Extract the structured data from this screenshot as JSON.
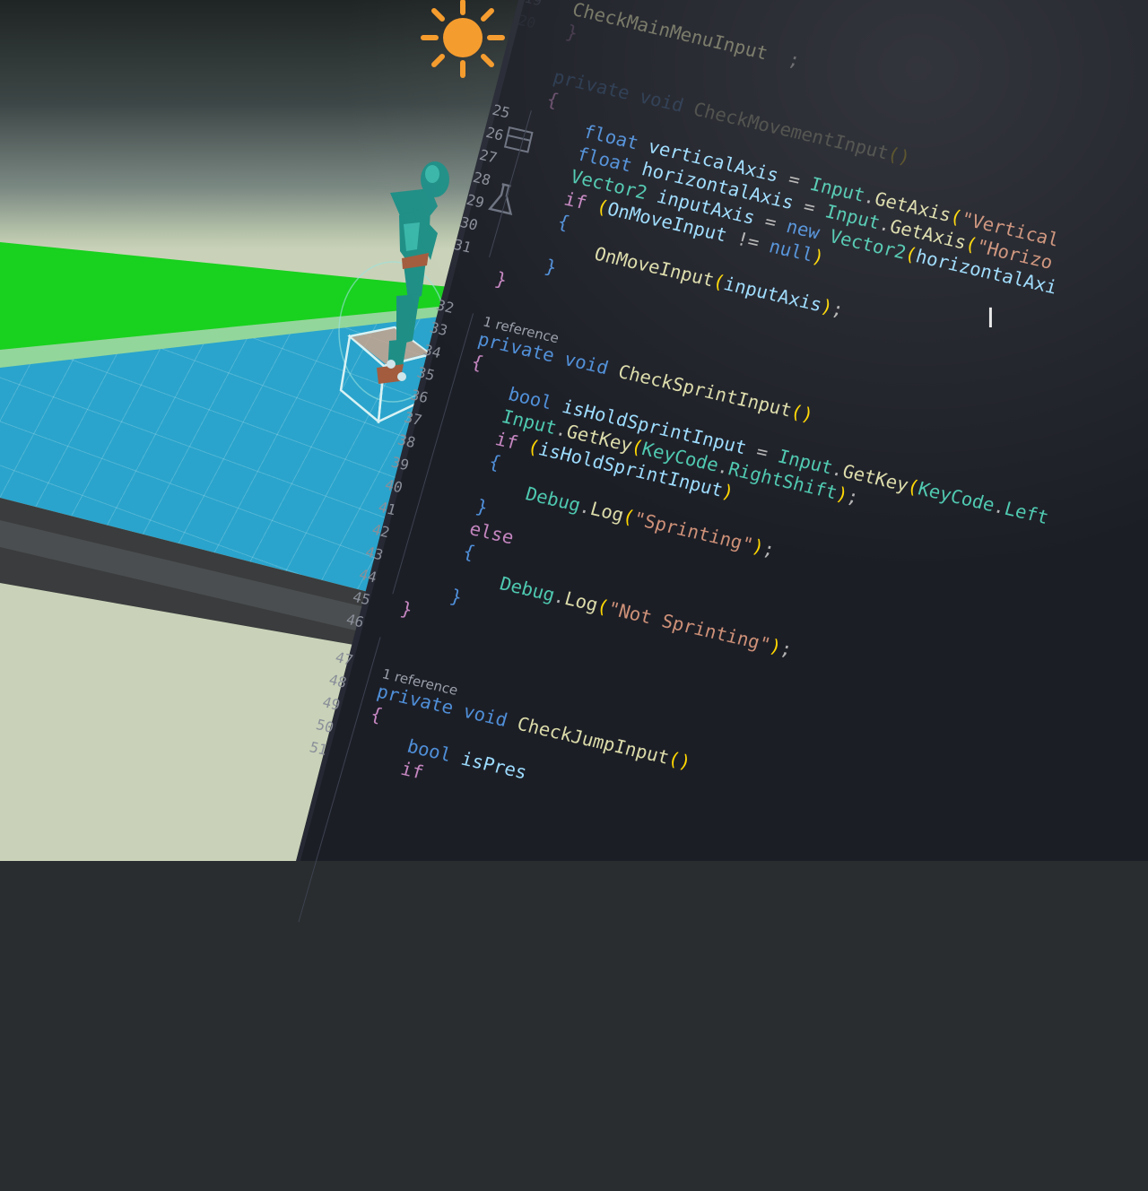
{
  "scene": {
    "sun_icon": "sun-icon",
    "character": "humanoid-character"
  },
  "editor": {
    "lines": [
      {
        "n": "18",
        "style": "faint2",
        "parts": []
      },
      {
        "n": "19",
        "style": "faint",
        "parts": [
          [
            "m",
            "CheckMainMenuInput"
          ],
          [
            "g",
            "  ;"
          ]
        ]
      },
      {
        "n": "20",
        "style": "faint2",
        "parts": [
          [
            "p",
            "}"
          ]
        ]
      },
      {
        "n": "",
        "style": "faint2",
        "parts": []
      },
      {
        "n": "",
        "style": "faint2",
        "parts": [
          [
            "k",
            "private void "
          ],
          [
            "m",
            "CheckMovementInput"
          ],
          [
            "y",
            "()"
          ]
        ]
      },
      {
        "n": "",
        "style": "faint",
        "parts": [
          [
            "p",
            "{"
          ]
        ]
      },
      {
        "n": "25",
        "style": "",
        "parts": [
          [
            "k",
            "    float "
          ],
          [
            "c",
            "verticalAxis"
          ],
          [
            "g",
            " = "
          ],
          [
            "t",
            "Input"
          ],
          [
            "g",
            "."
          ],
          [
            "m",
            "GetAxis"
          ],
          [
            "y",
            "("
          ],
          [
            "s",
            "\"Vertical"
          ]
        ]
      },
      {
        "n": "26",
        "style": "",
        "parts": [
          [
            "k",
            "    float "
          ],
          [
            "c",
            "horizontalAxis"
          ],
          [
            "g",
            " = "
          ],
          [
            "t",
            "Input"
          ],
          [
            "g",
            "."
          ],
          [
            "m",
            "GetAxis"
          ],
          [
            "y",
            "("
          ],
          [
            "s",
            "\"Horizo"
          ]
        ]
      },
      {
        "n": "27",
        "style": "",
        "parts": [
          [
            "t",
            "    Vector2 "
          ],
          [
            "c",
            "inputAxis"
          ],
          [
            "g",
            " = "
          ],
          [
            "k",
            "new "
          ],
          [
            "t",
            "Vector2"
          ],
          [
            "y",
            "("
          ],
          [
            "c",
            "horizontalAxi"
          ]
        ]
      },
      {
        "n": "28",
        "style": "",
        "parts": [
          [
            "p",
            "    if "
          ],
          [
            "y",
            "("
          ],
          [
            "c",
            "OnMoveInput"
          ],
          [
            "g",
            " != "
          ],
          [
            "k",
            "null"
          ],
          [
            "y",
            ")"
          ]
        ]
      },
      {
        "n": "29",
        "style": "",
        "parts": [
          [
            "k",
            "    {"
          ]
        ]
      },
      {
        "n": "30",
        "style": "",
        "parts": [
          [
            "m",
            "        OnMoveInput"
          ],
          [
            "y",
            "("
          ],
          [
            "c",
            "inputAxis"
          ],
          [
            "y",
            ")"
          ],
          [
            "g",
            ";"
          ]
        ]
      },
      {
        "n": "31",
        "style": "",
        "parts": [
          [
            "k",
            "    }"
          ]
        ]
      },
      {
        "n": "",
        "style": "",
        "parts": [
          [
            "p",
            "}"
          ]
        ]
      },
      {
        "n": "32",
        "style": "",
        "ref": "1 reference",
        "parts": []
      },
      {
        "n": "33",
        "style": "",
        "parts": [
          [
            "k",
            "private void "
          ],
          [
            "m",
            "CheckSprintInput"
          ],
          [
            "y",
            "()"
          ]
        ]
      },
      {
        "n": "34",
        "style": "",
        "parts": [
          [
            "p",
            "{"
          ]
        ]
      },
      {
        "n": "35",
        "style": "",
        "parts": [
          [
            "k",
            "    bool "
          ],
          [
            "c",
            "isHoldSprintInput"
          ],
          [
            "g",
            " = "
          ],
          [
            "t",
            "Input"
          ],
          [
            "g",
            "."
          ],
          [
            "m",
            "GetKey"
          ],
          [
            "y",
            "("
          ],
          [
            "t",
            "KeyCode"
          ],
          [
            "g",
            "."
          ],
          [
            "t",
            "Left"
          ]
        ]
      },
      {
        "n": "36",
        "style": "",
        "parts": [
          [
            "t",
            "    Input"
          ],
          [
            "g",
            "."
          ],
          [
            "m",
            "GetKey"
          ],
          [
            "y",
            "("
          ],
          [
            "t",
            "KeyCode"
          ],
          [
            "g",
            "."
          ],
          [
            "t",
            "RightShift"
          ],
          [
            "y",
            ")"
          ],
          [
            "g",
            ";"
          ]
        ]
      },
      {
        "n": "37",
        "style": "",
        "parts": [
          [
            "p",
            "    if "
          ],
          [
            "y",
            "("
          ],
          [
            "c",
            "isHoldSprintInput"
          ],
          [
            "y",
            ")"
          ]
        ]
      },
      {
        "n": "38",
        "style": "",
        "parts": [
          [
            "k",
            "    {"
          ]
        ]
      },
      {
        "n": "39",
        "style": "",
        "parts": [
          [
            "t",
            "        Debug"
          ],
          [
            "g",
            "."
          ],
          [
            "m",
            "Log"
          ],
          [
            "y",
            "("
          ],
          [
            "s",
            "\"Sprinting\""
          ],
          [
            "y",
            ")"
          ],
          [
            "g",
            ";"
          ]
        ]
      },
      {
        "n": "40",
        "style": "",
        "parts": [
          [
            "k",
            "    }"
          ]
        ]
      },
      {
        "n": "41",
        "style": "",
        "parts": [
          [
            "p",
            "    else"
          ]
        ]
      },
      {
        "n": "42",
        "style": "",
        "parts": [
          [
            "k",
            "    {"
          ]
        ]
      },
      {
        "n": "43",
        "style": "",
        "parts": [
          [
            "t",
            "        Debug"
          ],
          [
            "g",
            "."
          ],
          [
            "m",
            "Log"
          ],
          [
            "y",
            "("
          ],
          [
            "s",
            "\"Not Sprinting\""
          ],
          [
            "y",
            ")"
          ],
          [
            "g",
            ";"
          ]
        ]
      },
      {
        "n": "44",
        "style": "",
        "parts": [
          [
            "k",
            "    }"
          ]
        ]
      },
      {
        "n": "45",
        "style": "",
        "parts": [
          [
            "p",
            "}"
          ]
        ]
      },
      {
        "n": "46",
        "style": "",
        "parts": []
      },
      {
        "n": "47",
        "style": "",
        "ref": "1 reference",
        "parts": []
      },
      {
        "n": "48",
        "style": "",
        "parts": [
          [
            "k",
            "private void "
          ],
          [
            "m",
            "CheckJumpInput"
          ],
          [
            "y",
            "()"
          ]
        ]
      },
      {
        "n": "49",
        "style": "",
        "parts": [
          [
            "p",
            "{"
          ]
        ]
      },
      {
        "n": "50",
        "style": "",
        "parts": [
          [
            "k",
            "    bool "
          ],
          [
            "c",
            "isPres"
          ]
        ]
      },
      {
        "n": "51",
        "style": "",
        "parts": [
          [
            "p",
            "    if"
          ]
        ]
      }
    ]
  },
  "icons": {
    "gutter_1": "split-view-icon",
    "gutter_2": "flask-icon",
    "cursor": "text-cursor-icon"
  },
  "colors": {
    "editor_bg": "#1c1e26",
    "scene_ground_blue": "#2aa4cc",
    "scene_ground_green": "#19d11f",
    "sun": "#f59a2a"
  }
}
